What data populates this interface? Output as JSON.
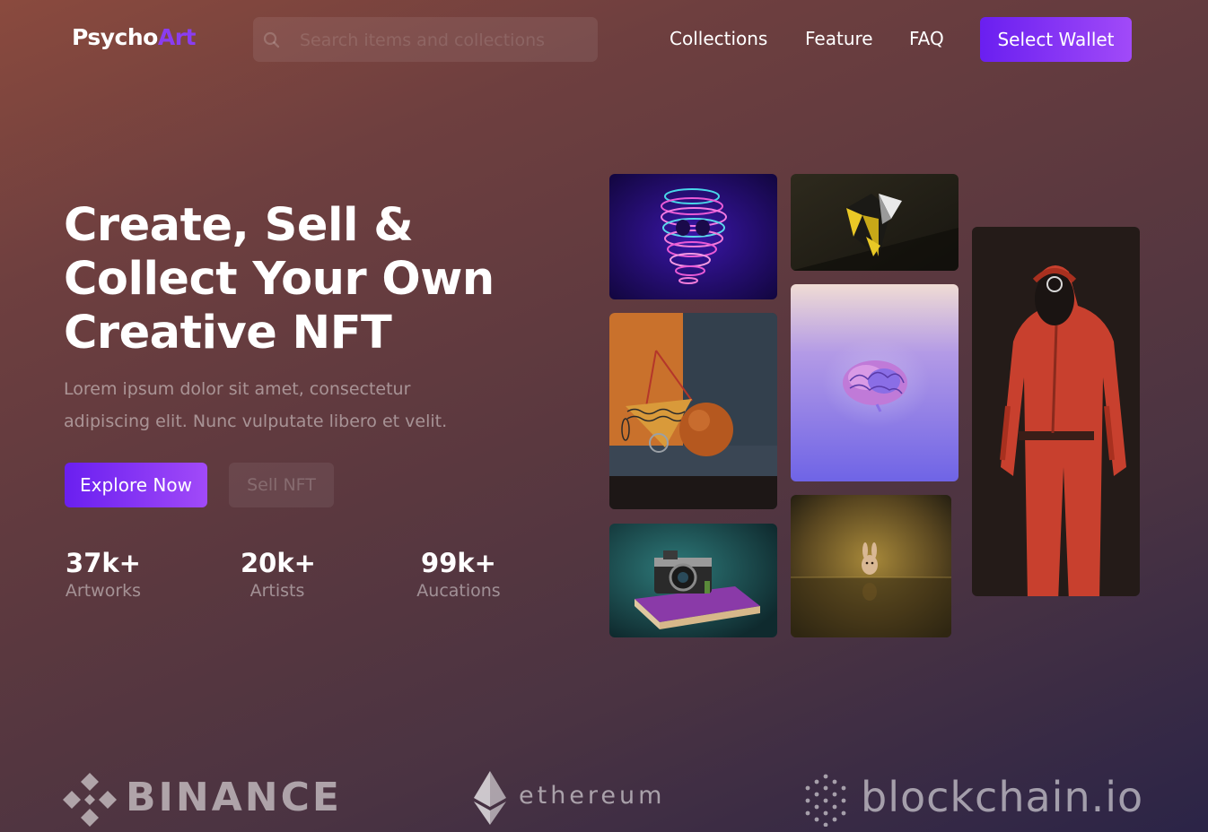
{
  "navbar": {
    "logo_main": "Psycho",
    "logo_accent": "Art",
    "search_placeholder": "Search items and collections",
    "links": [
      "Collections",
      "Feature",
      "FAQ"
    ],
    "wallet_button": "Select Wallet"
  },
  "hero": {
    "title_lines": [
      "Create, Sell &",
      "Collect Your Own",
      "Creative NFT"
    ],
    "subtitle_lines": [
      "Lorem ipsum dolor sit amet, consectetur",
      "adipiscing elit. Nunc vulputate libero et velit."
    ],
    "primary_button": "Explore Now",
    "secondary_button": "Sell NFT"
  },
  "stats": [
    {
      "value": "37k+",
      "label": "Artworks"
    },
    {
      "value": "20k+",
      "label": "Artists"
    },
    {
      "value": "99k+",
      "label": "Aucations"
    }
  ],
  "gallery": [
    {
      "name": "neon-wire-skull-art"
    },
    {
      "name": "geometric-yellow-black-art"
    },
    {
      "name": "abstract-room-sphere-art"
    },
    {
      "name": "glowing-brain-art"
    },
    {
      "name": "vintage-camera-on-book-art"
    },
    {
      "name": "tiny-bunny-figurine-art"
    },
    {
      "name": "red-jumpsuit-figure-art"
    }
  ],
  "partners": [
    "BINANCE",
    "ethereum",
    "blockchain.io"
  ],
  "colors": {
    "accent_purple": "#7a2cf3",
    "logo_accent": "#8a3df0"
  }
}
